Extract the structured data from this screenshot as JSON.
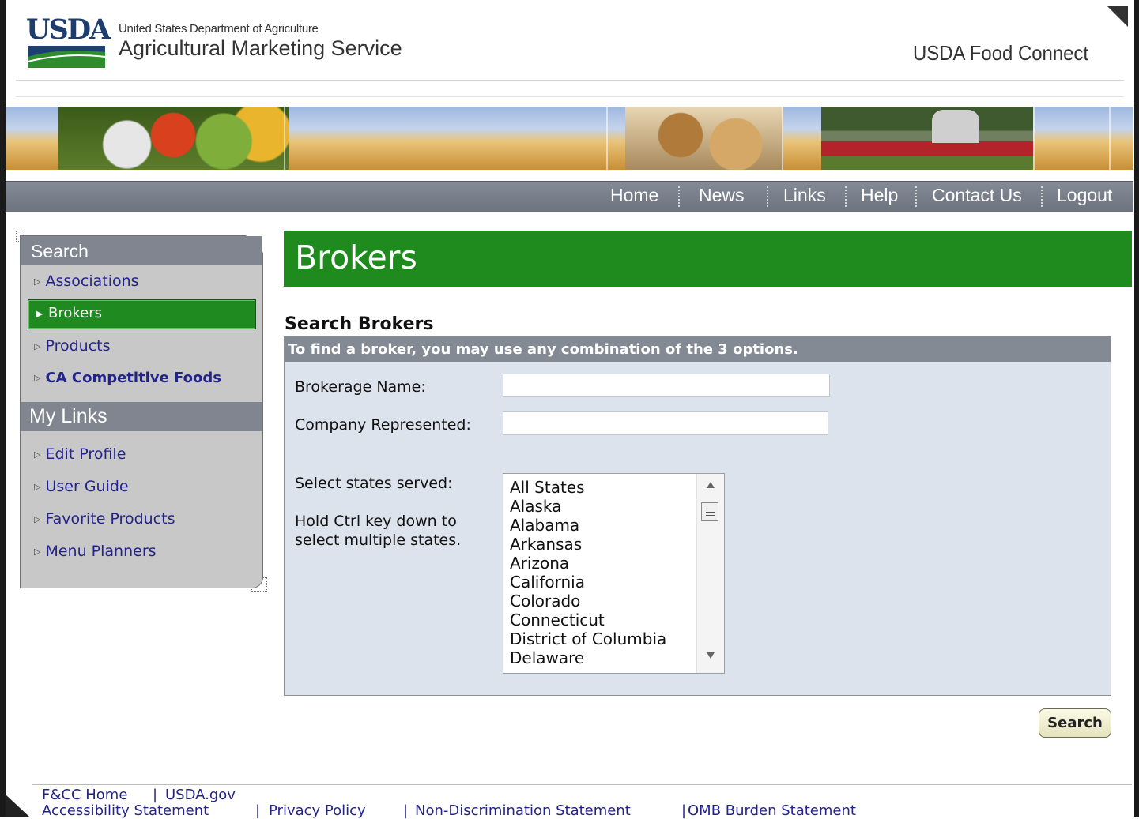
{
  "header": {
    "logo_text": "USDA",
    "department": "United States Department of Agriculture",
    "agency": "Agricultural Marketing Service",
    "site_title": "USDA Food Connect"
  },
  "nav": {
    "items": [
      "Home",
      "News",
      "Links",
      "Help",
      "Contact Us",
      "Logout"
    ]
  },
  "sidebar": {
    "search_heading": "Search",
    "search_items": [
      "Associations",
      "Brokers",
      "Products",
      "CA Competitive Foods"
    ],
    "active_item": "Brokers",
    "links_heading": "My Links",
    "link_items": [
      "Edit Profile",
      "User Guide",
      "Favorite Products",
      "Menu Planners"
    ]
  },
  "main": {
    "page_title": "Brokers",
    "section_heading": "Search Brokers",
    "hint": "To find a broker, you may use any combination of the 3 options.",
    "brokerage_label": "Brokerage Name:",
    "brokerage_value": "",
    "company_label": "Company Represented:",
    "company_value": "",
    "states_label": "Select states served:",
    "states_hint_1": "Hold Ctrl key down to",
    "states_hint_2": "select multiple states.",
    "states": [
      "All States",
      "Alaska",
      "Alabama",
      "Arkansas",
      "Arizona",
      "California",
      "Colorado",
      "Connecticut",
      "District of Columbia",
      "Delaware"
    ],
    "search_button": "Search"
  },
  "footer": {
    "row1": [
      "F&CC Home",
      "USDA.gov"
    ],
    "row2": [
      "Accessibility Statement",
      "Privacy Policy",
      "Non-Discrimination Statement",
      "OMB Burden Statement"
    ]
  },
  "colors": {
    "brand_green": "#1f8b1f",
    "nav_gray": "#7a808b",
    "link_blue": "#23238c",
    "panel_bg": "#dde3ec"
  }
}
